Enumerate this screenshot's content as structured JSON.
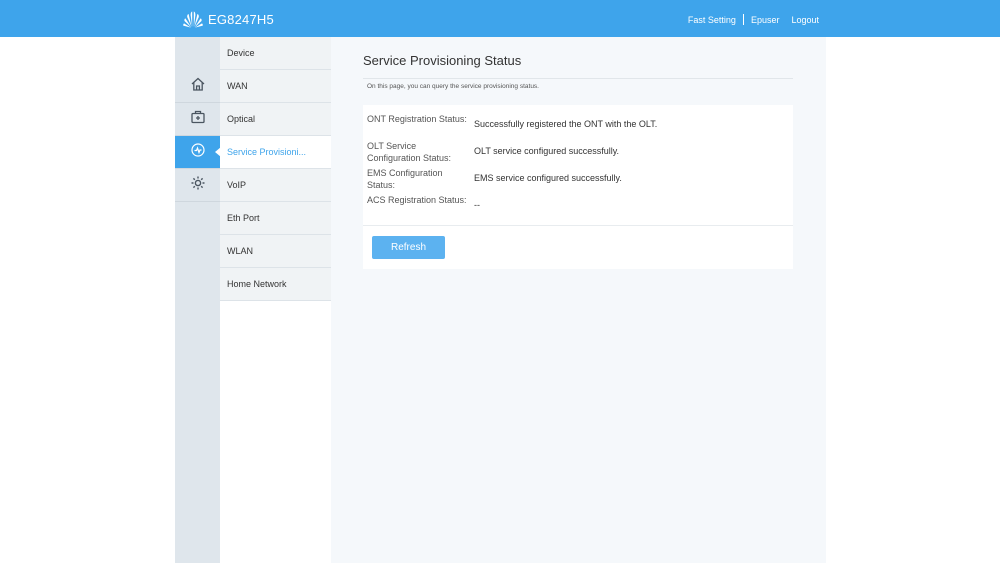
{
  "header": {
    "device_name": "EG8247H5",
    "logo_icon": "huawei-logo-icon",
    "links": {
      "fast_setting": "Fast Setting",
      "user": "Epuser",
      "logout": "Logout"
    },
    "bar_color": "#3ea4eb"
  },
  "rail": {
    "items": [
      {
        "icon": "home-icon"
      },
      {
        "icon": "toolbox-icon"
      },
      {
        "icon": "diagnostics-icon",
        "active": true
      },
      {
        "icon": "gear-icon"
      }
    ]
  },
  "submenu": {
    "items": [
      {
        "label": "Device"
      },
      {
        "label": "WAN"
      },
      {
        "label": "Optical"
      },
      {
        "label": "Service Provisioni...",
        "active": true
      },
      {
        "label": "VoIP"
      },
      {
        "label": "Eth Port"
      },
      {
        "label": "WLAN"
      },
      {
        "label": "Home Network"
      }
    ]
  },
  "main": {
    "title": "Service Provisioning Status",
    "description": "On this page, you can query the service provisioning status.",
    "rows": [
      {
        "label": "ONT Registration Status:",
        "value": "Successfully registered the ONT with the OLT."
      },
      {
        "label": "OLT Service Configuration Status:",
        "value": "OLT service configured successfully."
      },
      {
        "label": "EMS Configuration Status:",
        "value": "EMS service configured successfully."
      },
      {
        "label": "ACS Registration Status:",
        "value": "--"
      }
    ],
    "refresh_label": "Refresh"
  }
}
